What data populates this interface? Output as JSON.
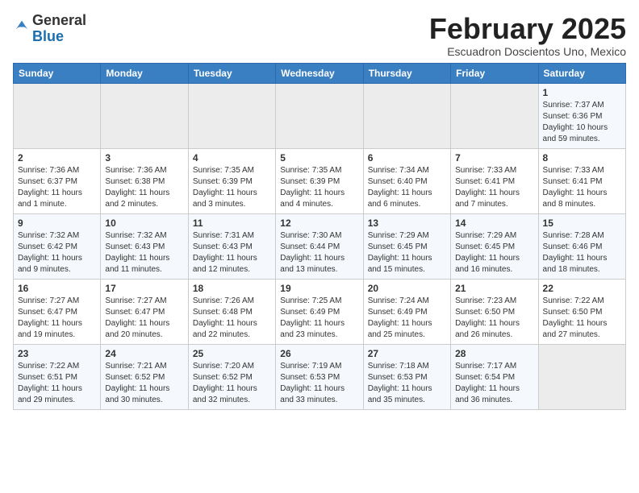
{
  "header": {
    "logo_general": "General",
    "logo_blue": "Blue",
    "month_title": "February 2025",
    "subtitle": "Escuadron Doscientos Uno, Mexico"
  },
  "weekdays": [
    "Sunday",
    "Monday",
    "Tuesday",
    "Wednesday",
    "Thursday",
    "Friday",
    "Saturday"
  ],
  "weeks": [
    [
      {
        "day": "",
        "info": ""
      },
      {
        "day": "",
        "info": ""
      },
      {
        "day": "",
        "info": ""
      },
      {
        "day": "",
        "info": ""
      },
      {
        "day": "",
        "info": ""
      },
      {
        "day": "",
        "info": ""
      },
      {
        "day": "1",
        "info": "Sunrise: 7:37 AM\nSunset: 6:36 PM\nDaylight: 10 hours and 59 minutes."
      }
    ],
    [
      {
        "day": "2",
        "info": "Sunrise: 7:36 AM\nSunset: 6:37 PM\nDaylight: 11 hours and 1 minute."
      },
      {
        "day": "3",
        "info": "Sunrise: 7:36 AM\nSunset: 6:38 PM\nDaylight: 11 hours and 2 minutes."
      },
      {
        "day": "4",
        "info": "Sunrise: 7:35 AM\nSunset: 6:39 PM\nDaylight: 11 hours and 3 minutes."
      },
      {
        "day": "5",
        "info": "Sunrise: 7:35 AM\nSunset: 6:39 PM\nDaylight: 11 hours and 4 minutes."
      },
      {
        "day": "6",
        "info": "Sunrise: 7:34 AM\nSunset: 6:40 PM\nDaylight: 11 hours and 6 minutes."
      },
      {
        "day": "7",
        "info": "Sunrise: 7:33 AM\nSunset: 6:41 PM\nDaylight: 11 hours and 7 minutes."
      },
      {
        "day": "8",
        "info": "Sunrise: 7:33 AM\nSunset: 6:41 PM\nDaylight: 11 hours and 8 minutes."
      }
    ],
    [
      {
        "day": "9",
        "info": "Sunrise: 7:32 AM\nSunset: 6:42 PM\nDaylight: 11 hours and 9 minutes."
      },
      {
        "day": "10",
        "info": "Sunrise: 7:32 AM\nSunset: 6:43 PM\nDaylight: 11 hours and 11 minutes."
      },
      {
        "day": "11",
        "info": "Sunrise: 7:31 AM\nSunset: 6:43 PM\nDaylight: 11 hours and 12 minutes."
      },
      {
        "day": "12",
        "info": "Sunrise: 7:30 AM\nSunset: 6:44 PM\nDaylight: 11 hours and 13 minutes."
      },
      {
        "day": "13",
        "info": "Sunrise: 7:29 AM\nSunset: 6:45 PM\nDaylight: 11 hours and 15 minutes."
      },
      {
        "day": "14",
        "info": "Sunrise: 7:29 AM\nSunset: 6:45 PM\nDaylight: 11 hours and 16 minutes."
      },
      {
        "day": "15",
        "info": "Sunrise: 7:28 AM\nSunset: 6:46 PM\nDaylight: 11 hours and 18 minutes."
      }
    ],
    [
      {
        "day": "16",
        "info": "Sunrise: 7:27 AM\nSunset: 6:47 PM\nDaylight: 11 hours and 19 minutes."
      },
      {
        "day": "17",
        "info": "Sunrise: 7:27 AM\nSunset: 6:47 PM\nDaylight: 11 hours and 20 minutes."
      },
      {
        "day": "18",
        "info": "Sunrise: 7:26 AM\nSunset: 6:48 PM\nDaylight: 11 hours and 22 minutes."
      },
      {
        "day": "19",
        "info": "Sunrise: 7:25 AM\nSunset: 6:49 PM\nDaylight: 11 hours and 23 minutes."
      },
      {
        "day": "20",
        "info": "Sunrise: 7:24 AM\nSunset: 6:49 PM\nDaylight: 11 hours and 25 minutes."
      },
      {
        "day": "21",
        "info": "Sunrise: 7:23 AM\nSunset: 6:50 PM\nDaylight: 11 hours and 26 minutes."
      },
      {
        "day": "22",
        "info": "Sunrise: 7:22 AM\nSunset: 6:50 PM\nDaylight: 11 hours and 27 minutes."
      }
    ],
    [
      {
        "day": "23",
        "info": "Sunrise: 7:22 AM\nSunset: 6:51 PM\nDaylight: 11 hours and 29 minutes."
      },
      {
        "day": "24",
        "info": "Sunrise: 7:21 AM\nSunset: 6:52 PM\nDaylight: 11 hours and 30 minutes."
      },
      {
        "day": "25",
        "info": "Sunrise: 7:20 AM\nSunset: 6:52 PM\nDaylight: 11 hours and 32 minutes."
      },
      {
        "day": "26",
        "info": "Sunrise: 7:19 AM\nSunset: 6:53 PM\nDaylight: 11 hours and 33 minutes."
      },
      {
        "day": "27",
        "info": "Sunrise: 7:18 AM\nSunset: 6:53 PM\nDaylight: 11 hours and 35 minutes."
      },
      {
        "day": "28",
        "info": "Sunrise: 7:17 AM\nSunset: 6:54 PM\nDaylight: 11 hours and 36 minutes."
      },
      {
        "day": "",
        "info": ""
      }
    ]
  ]
}
